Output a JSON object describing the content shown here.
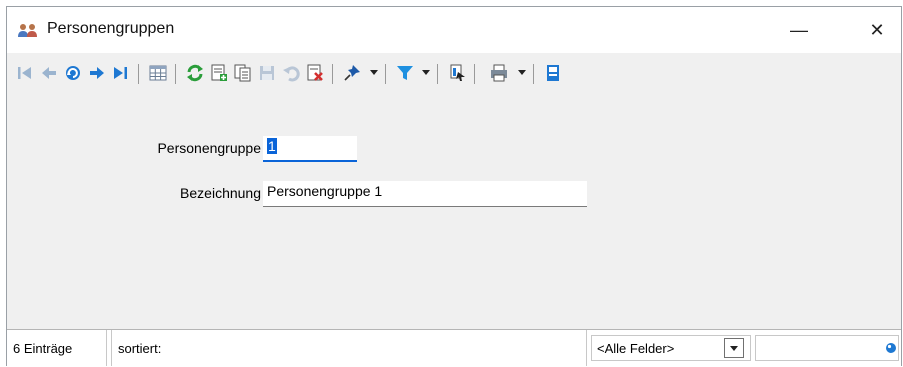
{
  "window": {
    "title": "Personengruppen",
    "title_icon": "users-icon",
    "minimize_symbol": "—",
    "close_symbol": "✕"
  },
  "toolbar": {
    "items": [
      "first-record-icon",
      "previous-record-icon",
      "go-to-record-icon",
      "next-record-icon",
      "last-record-icon",
      "table-view-icon",
      "refresh-icon",
      "new-record-icon",
      "copy-record-icon",
      "save-icon",
      "undo-icon",
      "delete-icon",
      "pin-icon",
      "filter-icon",
      "export-icon",
      "print-icon",
      "details-icon"
    ]
  },
  "form": {
    "personengruppe_label": "Personengruppe",
    "personengruppe_value": "1",
    "bezeichnung_label": "Bezeichnung",
    "bezeichnung_value": "Personengruppe 1"
  },
  "status": {
    "count": "6 Einträge",
    "sort_label": "sortiert:",
    "field_select": "<Alle Felder>",
    "search_value": ""
  },
  "colors": {
    "accent": "#0a64d8",
    "nav_blue": "#1e78d2",
    "refresh_green": "#2a9d3a",
    "delete_red": "#d32f2f"
  }
}
